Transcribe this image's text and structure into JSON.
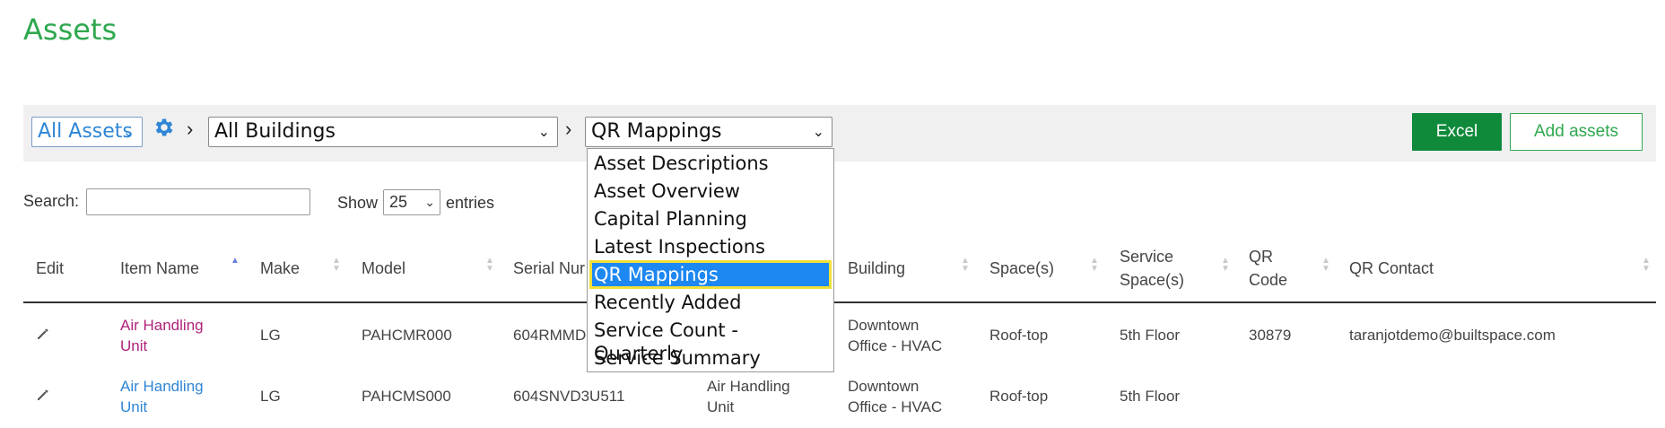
{
  "page": {
    "title": "Assets"
  },
  "toolbar": {
    "asset_filter": "All Assets",
    "building_filter": "All Buildings",
    "report_view": "QR Mappings",
    "excel_label": "Excel",
    "add_label": "Add assets",
    "icons": {
      "settings": "gear-icon",
      "breadcrumb": "chevron-right-icon",
      "dropdown": "chevron-down-icon"
    }
  },
  "controls": {
    "search_label": "Search:",
    "search_value": "",
    "show_label": "Show",
    "page_size": "25",
    "entries_label": "entries"
  },
  "report_menu": {
    "options": [
      "Asset Descriptions",
      "Asset Overview",
      "Capital Planning",
      "Latest Inspections",
      "QR Mappings",
      "Recently Added",
      "Service Count - Quarterly",
      "Service Summary"
    ],
    "selected": "QR Mappings"
  },
  "table": {
    "headers": {
      "edit": "Edit",
      "item_name": "Item Name",
      "make": "Make",
      "model": "Model",
      "serial": "Serial Nur",
      "building": "Building",
      "spaces": "Space(s)",
      "service_spaces_1": "Service",
      "service_spaces_2": "Space(s)",
      "qr_code_1": "QR",
      "qr_code_2": "Code",
      "qr_contact": "QR Contact"
    },
    "rows": [
      {
        "item_name_1": "Air Handling",
        "item_name_2": "Unit",
        "make": "LG",
        "model": "PAHCMR000",
        "serial": "604RMMD",
        "type_1": "",
        "type_2": "",
        "building_1": "Downtown",
        "building_2": "Office - HVAC",
        "spaces": "Roof-top",
        "service_spaces": "5th Floor",
        "qr_code": "30879",
        "qr_contact": "taranjotdemo@builtspace.com"
      },
      {
        "item_name_1": "Air Handling",
        "item_name_2": "Unit",
        "make": "LG",
        "model": "PAHCMS000",
        "serial": "604SNVD3U511",
        "type_1": "Air Handling",
        "type_2": "Unit",
        "building_1": "Downtown",
        "building_2": "Office - HVAC",
        "spaces": "Roof-top",
        "service_spaces": "5th Floor",
        "qr_code": "",
        "qr_contact": ""
      }
    ]
  },
  "colors": {
    "brand_green": "#2fa84f",
    "button_green": "#0f8a3a",
    "link_blue": "#2f86d6",
    "link_pink": "#b0237a",
    "selection_blue": "#1e88f2",
    "focus_yellow": "#f2e03a"
  }
}
